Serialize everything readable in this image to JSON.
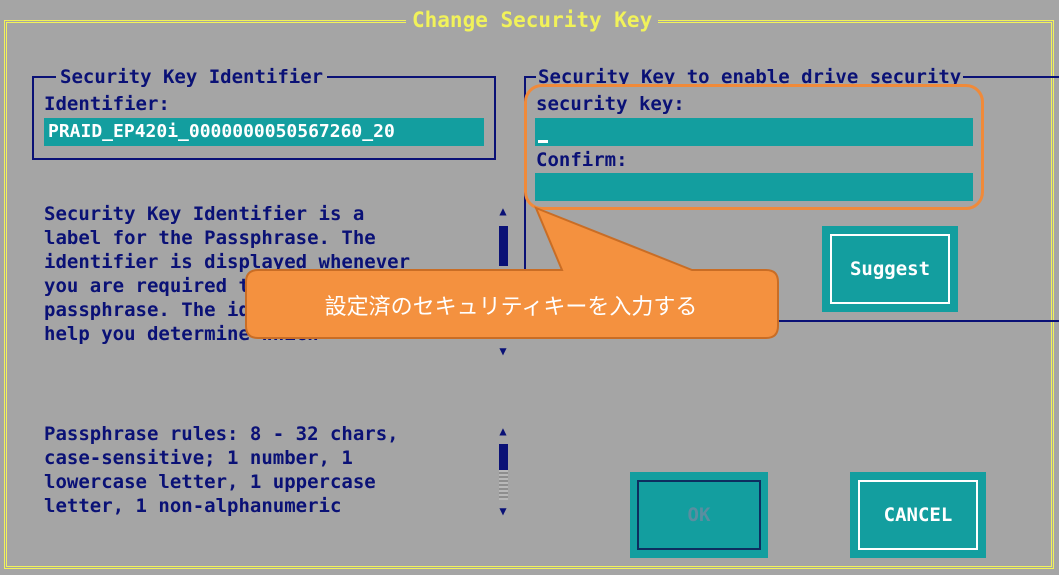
{
  "window": {
    "title": "Change Security Key"
  },
  "left_group": {
    "title": "Security Key Identifier",
    "identifier_label": "Identifier:",
    "identifier_value": "PRAID_EP420i_0000000050567260_20"
  },
  "right_group": {
    "title": "Security Key to enable drive security",
    "security_key_label": "security key:",
    "security_key_value": "",
    "confirm_label": "Confirm:",
    "confirm_value": ""
  },
  "help_text": {
    "lines": [
      "Security Key Identifier is a",
      "label for the Passphrase. The",
      "identifier is displayed whenever",
      "you are required to enter the",
      "passphrase. The identifier will",
      "help you determine which"
    ]
  },
  "rules_text": {
    "lines": [
      "Passphrase rules: 8 - 32 chars,",
      "case-sensitive; 1 number, 1",
      "lowercase letter, 1 uppercase",
      "letter, 1 non-alphanumeric"
    ]
  },
  "buttons": {
    "suggest": "Suggest",
    "ok": "OK",
    "cancel": "CANCEL"
  },
  "annotation": {
    "text": "設定済のセキュリティキーを入力する"
  },
  "colors": {
    "background": "#a5a5a5",
    "text": "#0a1176",
    "field": "#139e9f",
    "frame": "#f1f25a",
    "callout": "#f4913f"
  },
  "icons": {
    "scroll_up": "up-arrow-icon",
    "scroll_down": "down-arrow-icon"
  }
}
